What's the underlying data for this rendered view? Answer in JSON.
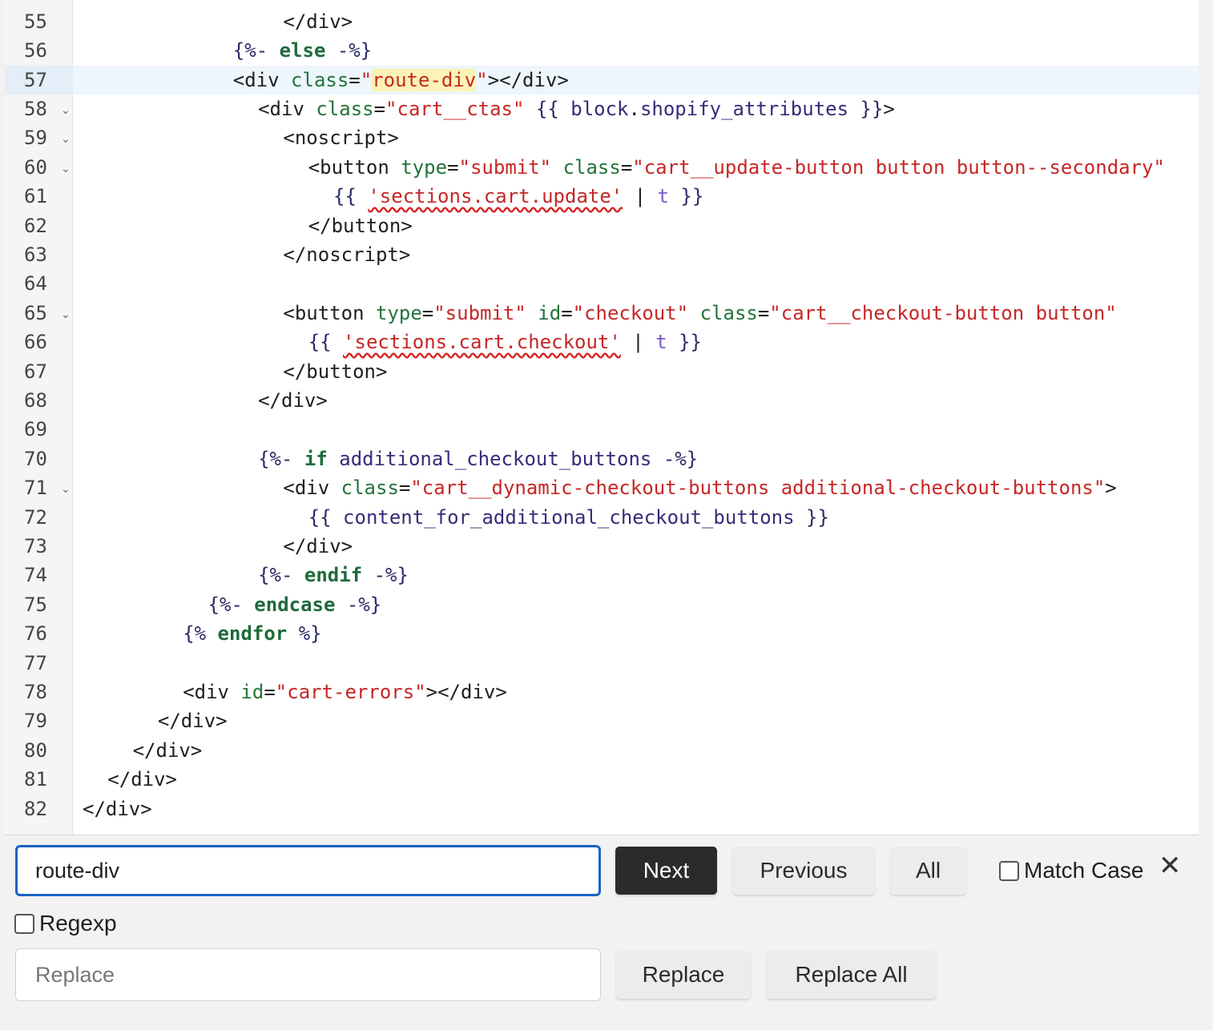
{
  "editor": {
    "active_line": 57,
    "lines": [
      {
        "n": "55",
        "fold": false,
        "indent": 8,
        "html": "<span class='tag'>&lt;/div&gt;</span>"
      },
      {
        "n": "56",
        "fold": false,
        "indent": 6,
        "html": "<span class='liq'>{%- </span><span class='kw'>else</span><span class='liq'> -%}</span>"
      },
      {
        "n": "57",
        "fold": false,
        "indent": 6,
        "html": "<span class='tag'>&lt;div </span><span class='attr'>class</span>=<span class='str'>\"<span class='hl'>route-div</span>\"</span><span class='tag'>&gt;&lt;/div&gt;</span>"
      },
      {
        "n": "58",
        "fold": true,
        "indent": 7,
        "html": "<span class='tag'>&lt;div </span><span class='attr'>class</span>=<span class='str'>\"cart__ctas\"</span> <span class='liq'>{{ </span><span class='var'>block</span>.<span class='var'>shopify_attributes</span><span class='liq'> }}</span><span class='tag'>&gt;</span>"
      },
      {
        "n": "59",
        "fold": true,
        "indent": 8,
        "html": "<span class='tag'>&lt;noscript&gt;</span>"
      },
      {
        "n": "60",
        "fold": true,
        "indent": 9,
        "html": "<span class='tag'>&lt;button </span><span class='attr'>type</span>=<span class='str'>\"submit\"</span> <span class='attr'>class</span>=<span class='str'>\"cart__update-button button button--secondary\"</span>"
      },
      {
        "n": "61",
        "fold": false,
        "indent": 10,
        "html": "<span class='liq'>{{ </span><span class='str squig'>'sections.cart.update'</span> | <span class='flt'>t</span><span class='liq'> }}</span>"
      },
      {
        "n": "62",
        "fold": false,
        "indent": 9,
        "html": "<span class='tag'>&lt;/button&gt;</span>"
      },
      {
        "n": "63",
        "fold": false,
        "indent": 8,
        "html": "<span class='tag'>&lt;/noscript&gt;</span>"
      },
      {
        "n": "64",
        "fold": false,
        "indent": 0,
        "html": ""
      },
      {
        "n": "65",
        "fold": true,
        "indent": 8,
        "html": "<span class='tag'>&lt;button </span><span class='attr'>type</span>=<span class='str'>\"submit\"</span> <span class='attr'>id</span>=<span class='str'>\"checkout\"</span> <span class='attr'>class</span>=<span class='str'>\"cart__checkout-button button\"</span>"
      },
      {
        "n": "66",
        "fold": false,
        "indent": 9,
        "html": "<span class='liq'>{{ </span><span class='str squig'>'sections.cart.checkout'</span> | <span class='flt'>t</span><span class='liq'> }}</span>"
      },
      {
        "n": "67",
        "fold": false,
        "indent": 8,
        "html": "<span class='tag'>&lt;/button&gt;</span>"
      },
      {
        "n": "68",
        "fold": false,
        "indent": 7,
        "html": "<span class='tag'>&lt;/div&gt;</span>"
      },
      {
        "n": "69",
        "fold": false,
        "indent": 0,
        "html": ""
      },
      {
        "n": "70",
        "fold": false,
        "indent": 7,
        "html": "<span class='liq'>{%- </span><span class='kw'>if</span> <span class='var'>additional_checkout_buttons</span><span class='liq'> -%}</span>"
      },
      {
        "n": "71",
        "fold": true,
        "indent": 8,
        "html": "<span class='tag'>&lt;div </span><span class='attr'>class</span>=<span class='str'>\"cart__dynamic-checkout-buttons additional-checkout-buttons\"</span><span class='tag'>&gt;</span>"
      },
      {
        "n": "72",
        "fold": false,
        "indent": 9,
        "html": "<span class='liq'>{{ </span><span class='var'>content_for_additional_checkout_buttons</span><span class='liq'> }}</span>"
      },
      {
        "n": "73",
        "fold": false,
        "indent": 8,
        "html": "<span class='tag'>&lt;/div&gt;</span>"
      },
      {
        "n": "74",
        "fold": false,
        "indent": 7,
        "html": "<span class='liq'>{%- </span><span class='kw'>endif</span><span class='liq'> -%}</span>"
      },
      {
        "n": "75",
        "fold": false,
        "indent": 5,
        "html": "<span class='liq'>{%- </span><span class='kw'>endcase</span><span class='liq'> -%}</span>"
      },
      {
        "n": "76",
        "fold": false,
        "indent": 4,
        "html": "<span class='liq'>{% </span><span class='kw'>endfor</span><span class='liq'> %}</span>"
      },
      {
        "n": "77",
        "fold": false,
        "indent": 0,
        "html": ""
      },
      {
        "n": "78",
        "fold": false,
        "indent": 4,
        "html": "<span class='tag'>&lt;div </span><span class='attr'>id</span>=<span class='str'>\"cart-errors\"</span><span class='tag'>&gt;&lt;/div&gt;</span>"
      },
      {
        "n": "79",
        "fold": false,
        "indent": 3,
        "html": "<span class='tag'>&lt;/div&gt;</span>"
      },
      {
        "n": "80",
        "fold": false,
        "indent": 2,
        "html": "<span class='tag'>&lt;/div&gt;</span>"
      },
      {
        "n": "81",
        "fold": false,
        "indent": 1,
        "html": "<span class='tag'>&lt;/div&gt;</span>"
      },
      {
        "n": "82",
        "fold": false,
        "indent": 0,
        "html": "<span class='tag'>&lt;/div&gt;</span>"
      }
    ]
  },
  "find": {
    "search_value": "route-div",
    "next_label": "Next",
    "previous_label": "Previous",
    "all_label": "All",
    "match_case_label": "Match Case",
    "regexp_label": "Regexp",
    "replace_placeholder": "Replace",
    "replace_label": "Replace",
    "replace_all_label": "Replace All",
    "close_glyph": "✕"
  },
  "colors": {
    "accent_focus": "#1663c7",
    "primary_button": "#2b2b2b",
    "active_line_bg": "#eef6fd",
    "match_highlight": "#fbf3b5"
  }
}
